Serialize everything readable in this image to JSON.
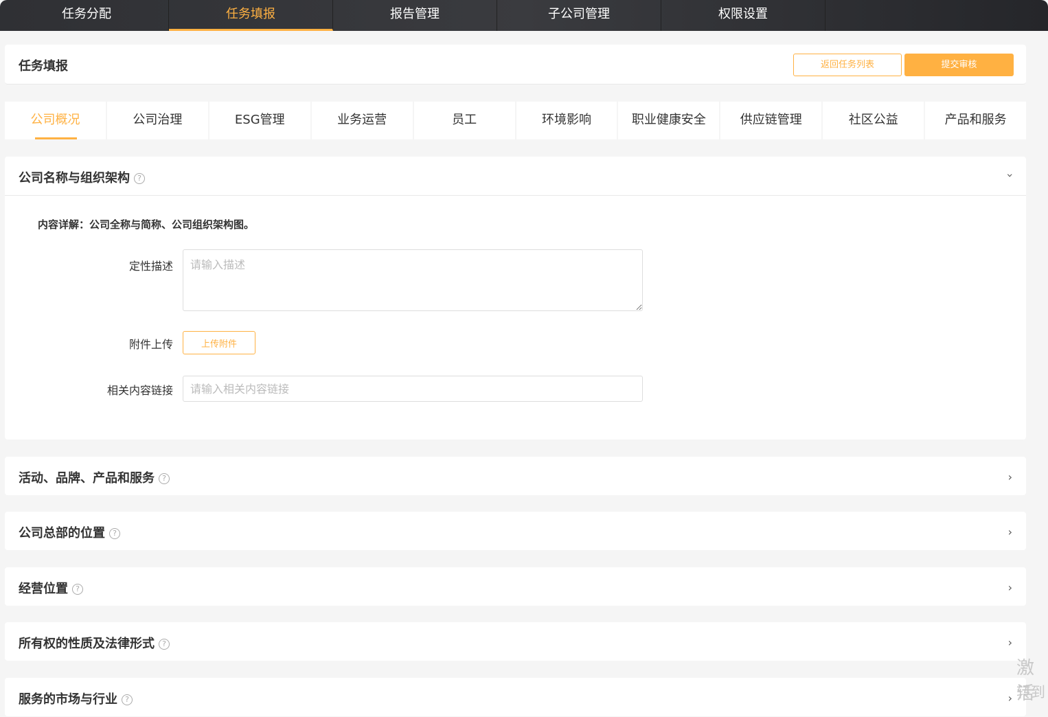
{
  "topnav": [
    "任务分配",
    "任务填报",
    "报告管理",
    "子公司管理",
    "权限设置"
  ],
  "header": {
    "title": "任务填报",
    "back": "返回任务列表",
    "submit": "提交审核"
  },
  "tabs": [
    "公司概况",
    "公司治理",
    "ESG管理",
    "业务运营",
    "员工",
    "环境影响",
    "职业健康安全",
    "供应链管理",
    "社区公益",
    "产品和服务"
  ],
  "open_section": {
    "title": "公司名称与组织架构",
    "detail": "内容详解：公司全称与简称、公司组织架构图。",
    "desc_label": "定性描述",
    "desc_placeholder": "请输入描述",
    "attach_label": "附件上传",
    "upload": "上传附件",
    "link_label": "相关内容链接",
    "link_placeholder": "请输入相关内容链接"
  },
  "sections": [
    "活动、品牌、产品和服务",
    "公司总部的位置",
    "经营位置",
    "所有权的性质及法律形式",
    "服务的市场与行业"
  ],
  "watermark": [
    "激活",
    "转到"
  ]
}
